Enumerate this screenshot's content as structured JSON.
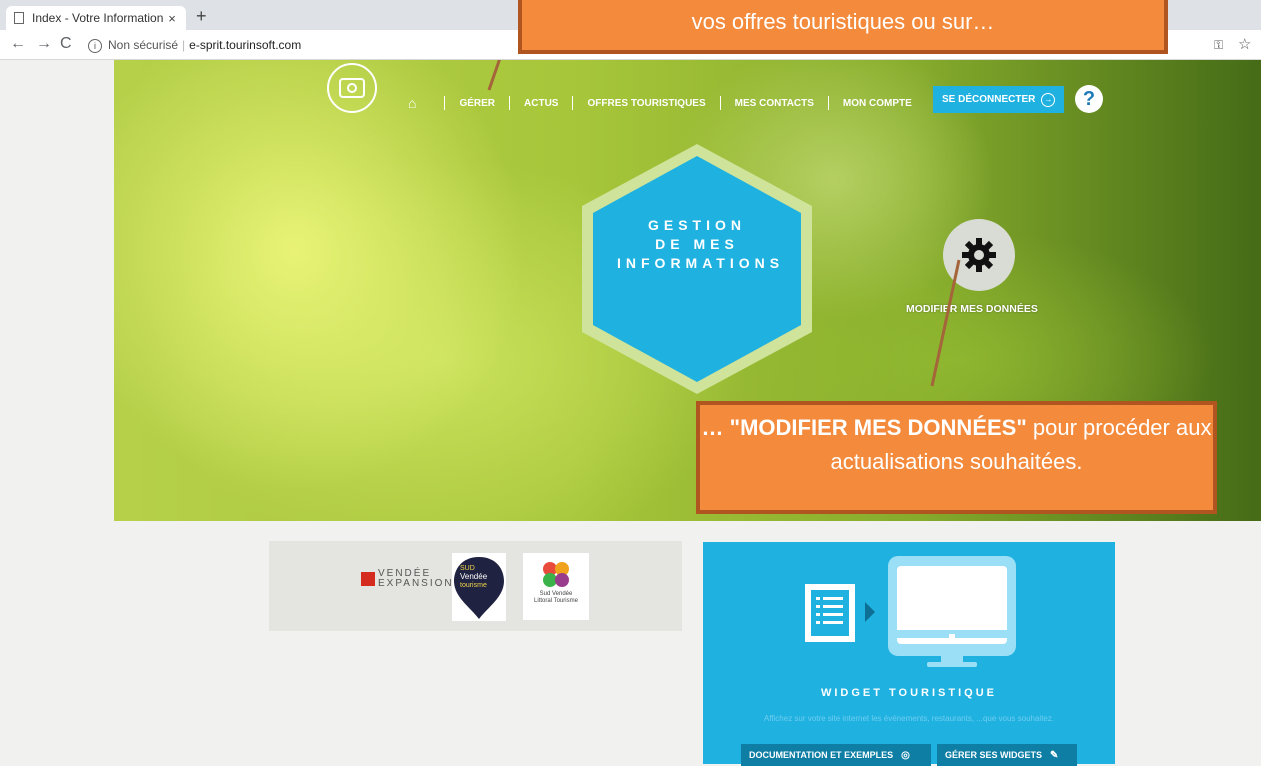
{
  "browser": {
    "tab_title": "Index - Votre Information Touristi",
    "tab_close": "×",
    "new_tab": "+",
    "security_label": "Non sécurisé",
    "url": "e-sprit.tourinsoft.com"
  },
  "nav": {
    "items": [
      "GÉRER",
      "ACTUS",
      "OFFRES TOURISTIQUES",
      "MES CONTACTS",
      "MON COMPTE"
    ],
    "logout_label": "SE DÉCONNECTER",
    "help_label": "?"
  },
  "hero": {
    "hex_lines": [
      "GESTION",
      "DE MES",
      "INFORMATIONS"
    ],
    "modify_label": "MODIFIER MES DONNÉES"
  },
  "callouts": {
    "top": "vos offres touristiques ou sur…",
    "bottom_bold": "… \"MODIFIER MES DONNÉES\"",
    "bottom_rest": " pour procéder aux actualisations souhaitées."
  },
  "partners": {
    "vendee_name": "VENDÉE",
    "vendee_sub": "EXPANSION",
    "sud_vendee_lines": [
      "SUD",
      "Vendée",
      "tourisme"
    ],
    "slt_lines": [
      "Sud Vendée",
      "Littoral Tourisme"
    ]
  },
  "widget": {
    "title": "WIDGET TOURISTIQUE",
    "description": "Affichez sur votre site internet les événements, restaurants, ...que vous souhaitez.",
    "doc_button": "DOCUMENTATION ET EXEMPLES",
    "manage_button": "GÉRER SES WIDGETS"
  },
  "colors": {
    "accent_blue": "#1fb1e0",
    "callout_orange": "#f48a3c",
    "callout_border": "#b0551f",
    "hex_fill": "#1fb1e0"
  }
}
